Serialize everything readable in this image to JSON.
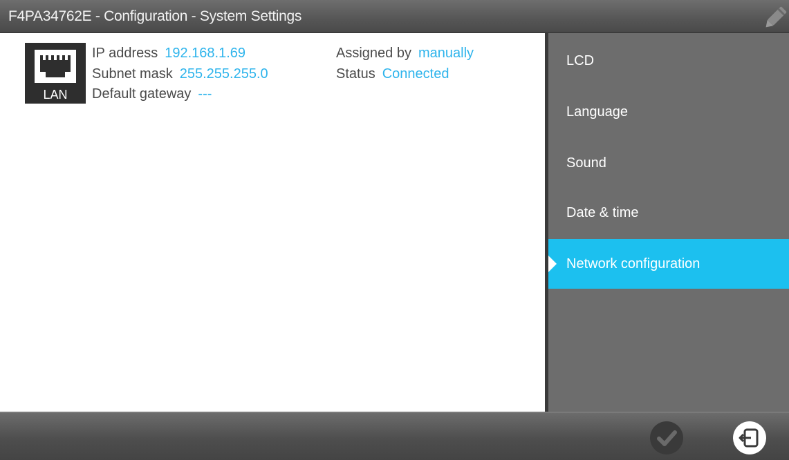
{
  "window": {
    "title": "F4PA34762E - Configuration - System Settings"
  },
  "network": {
    "icon_label": "LAN",
    "ip_address_label": "IP address",
    "ip_address_value": "192.168.1.69",
    "subnet_mask_label": "Subnet mask",
    "subnet_mask_value": "255.255.255.0",
    "default_gateway_label": "Default gateway",
    "default_gateway_value": "---",
    "assigned_by_label": "Assigned by",
    "assigned_by_value": "manually",
    "status_label": "Status",
    "status_value": "Connected"
  },
  "sidebar": {
    "items": [
      {
        "label": "LCD",
        "active": false
      },
      {
        "label": "Language",
        "active": false
      },
      {
        "label": "Sound",
        "active": false
      },
      {
        "label": "Date & time",
        "active": false
      },
      {
        "label": "Network configuration",
        "active": true
      }
    ]
  },
  "footer": {
    "confirm_icon": "checkmark-circle-icon",
    "exit_icon": "exit-icon"
  },
  "colors": {
    "accent": "#1cc0ef",
    "value_text": "#2eb4ec",
    "sidebar_bg": "#6d6d6d",
    "bar_bg": "#555555"
  }
}
